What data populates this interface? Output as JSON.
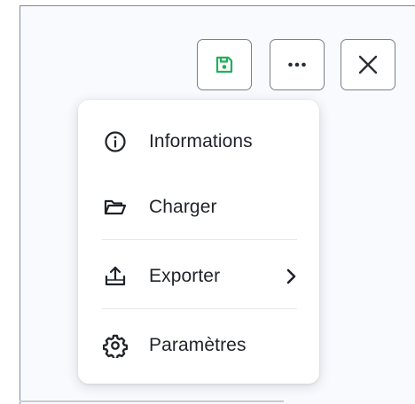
{
  "toolbar": {
    "save_icon": "save-icon",
    "more_icon": "more-horizontal-icon",
    "close_icon": "close-icon",
    "save_color": "#22b05a"
  },
  "menu": {
    "items": [
      {
        "label": "Informations",
        "icon": "info-icon"
      },
      {
        "label": "Charger",
        "icon": "folder-open-icon"
      },
      {
        "label": "Exporter",
        "icon": "upload-icon",
        "submenu": true
      },
      {
        "label": "Paramètres",
        "icon": "gear-icon"
      }
    ]
  }
}
